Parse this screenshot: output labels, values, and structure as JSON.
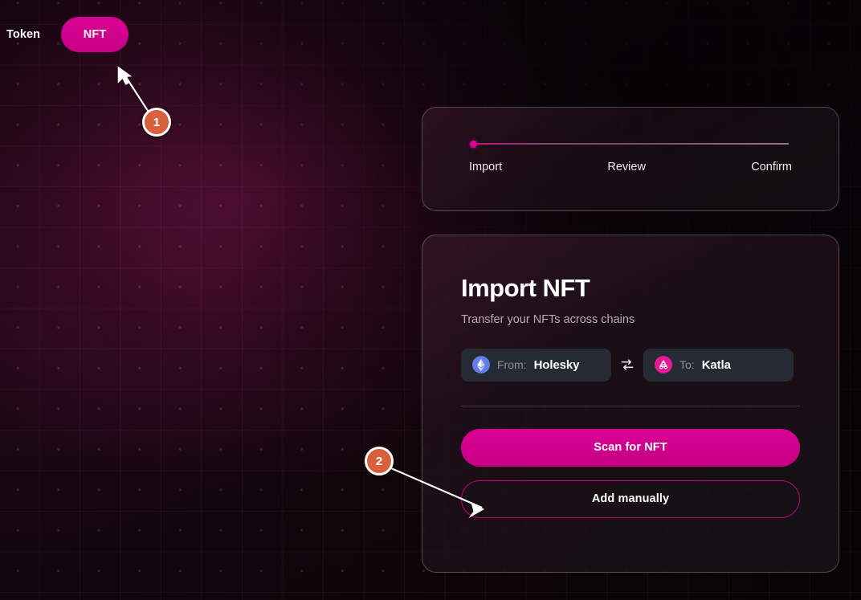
{
  "theme": {
    "accent_pink": "#d4008d",
    "marker_orange": "#d9603c",
    "card_border": "#cdc3d2",
    "chain_box_bg": "#262a33",
    "ethereum_blue": "#627eea",
    "taiko_pink": "#e81899",
    "background_dark": "#0b0408"
  },
  "tabs": {
    "token_label": "Token",
    "nft_label": "NFT",
    "active": "NFT"
  },
  "stepper": {
    "steps": [
      {
        "label": "Import",
        "state": "active"
      },
      {
        "label": "Review",
        "state": "pending"
      },
      {
        "label": "Confirm",
        "state": "pending"
      }
    ],
    "current_index": 0
  },
  "main": {
    "title": "Import NFT",
    "subtitle": "Transfer your NFTs across chains",
    "from": {
      "label": "From:",
      "value": "Holesky",
      "icon": "ethereum-icon"
    },
    "to": {
      "label": "To:",
      "value": "Katla",
      "icon": "taiko-icon"
    },
    "swap_icon": "swap-arrows-icon",
    "actions": {
      "scan_label": "Scan for NFT",
      "manual_label": "Add manually"
    }
  },
  "annotations": [
    {
      "id": "1",
      "label": "1",
      "target": "nft-tab"
    },
    {
      "id": "2",
      "label": "2",
      "target": "add-manually-button"
    }
  ]
}
